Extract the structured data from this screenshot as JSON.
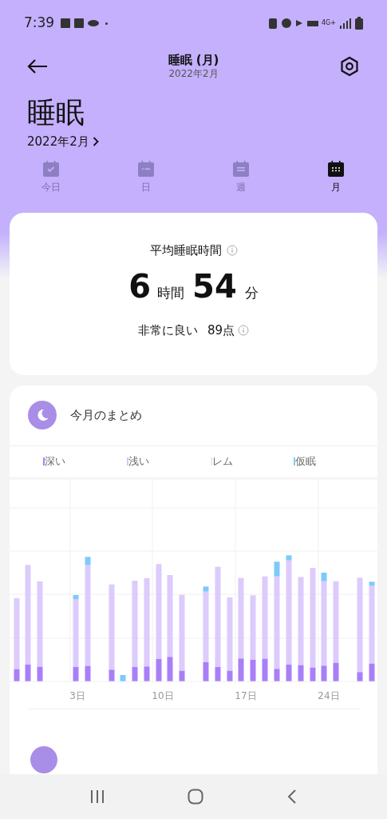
{
  "status_bar": {
    "time": "7:39",
    "network": "4G+"
  },
  "header": {
    "title": "睡眠 (月)",
    "subtitle": "2022年2月"
  },
  "page_title": "睡眠",
  "period_link": "2022年2月",
  "tabs": [
    {
      "kind": "today",
      "label": "今日",
      "selected": false
    },
    {
      "kind": "day",
      "label": "日",
      "selected": false
    },
    {
      "kind": "week",
      "label": "週",
      "selected": false
    },
    {
      "kind": "month",
      "label": "月",
      "selected": true
    }
  ],
  "average_card": {
    "title": "平均睡眠時間",
    "hours": "6",
    "hours_unit": "時間",
    "minutes": "54",
    "minutes_unit": "分",
    "rating": "非常に良い",
    "score": "89点"
  },
  "summary_card": {
    "title": "今月のまとめ",
    "legend": [
      {
        "label": "深い",
        "color": "#a97ff8"
      },
      {
        "label": "浅い",
        "color": "#d6c6fb"
      },
      {
        "label": "レム",
        "color": "#ede4fd"
      },
      {
        "label": "仮眠",
        "color": "#7dcafa"
      }
    ],
    "x_labels": [
      "3日",
      "10日",
      "17日",
      "24日"
    ]
  }
}
